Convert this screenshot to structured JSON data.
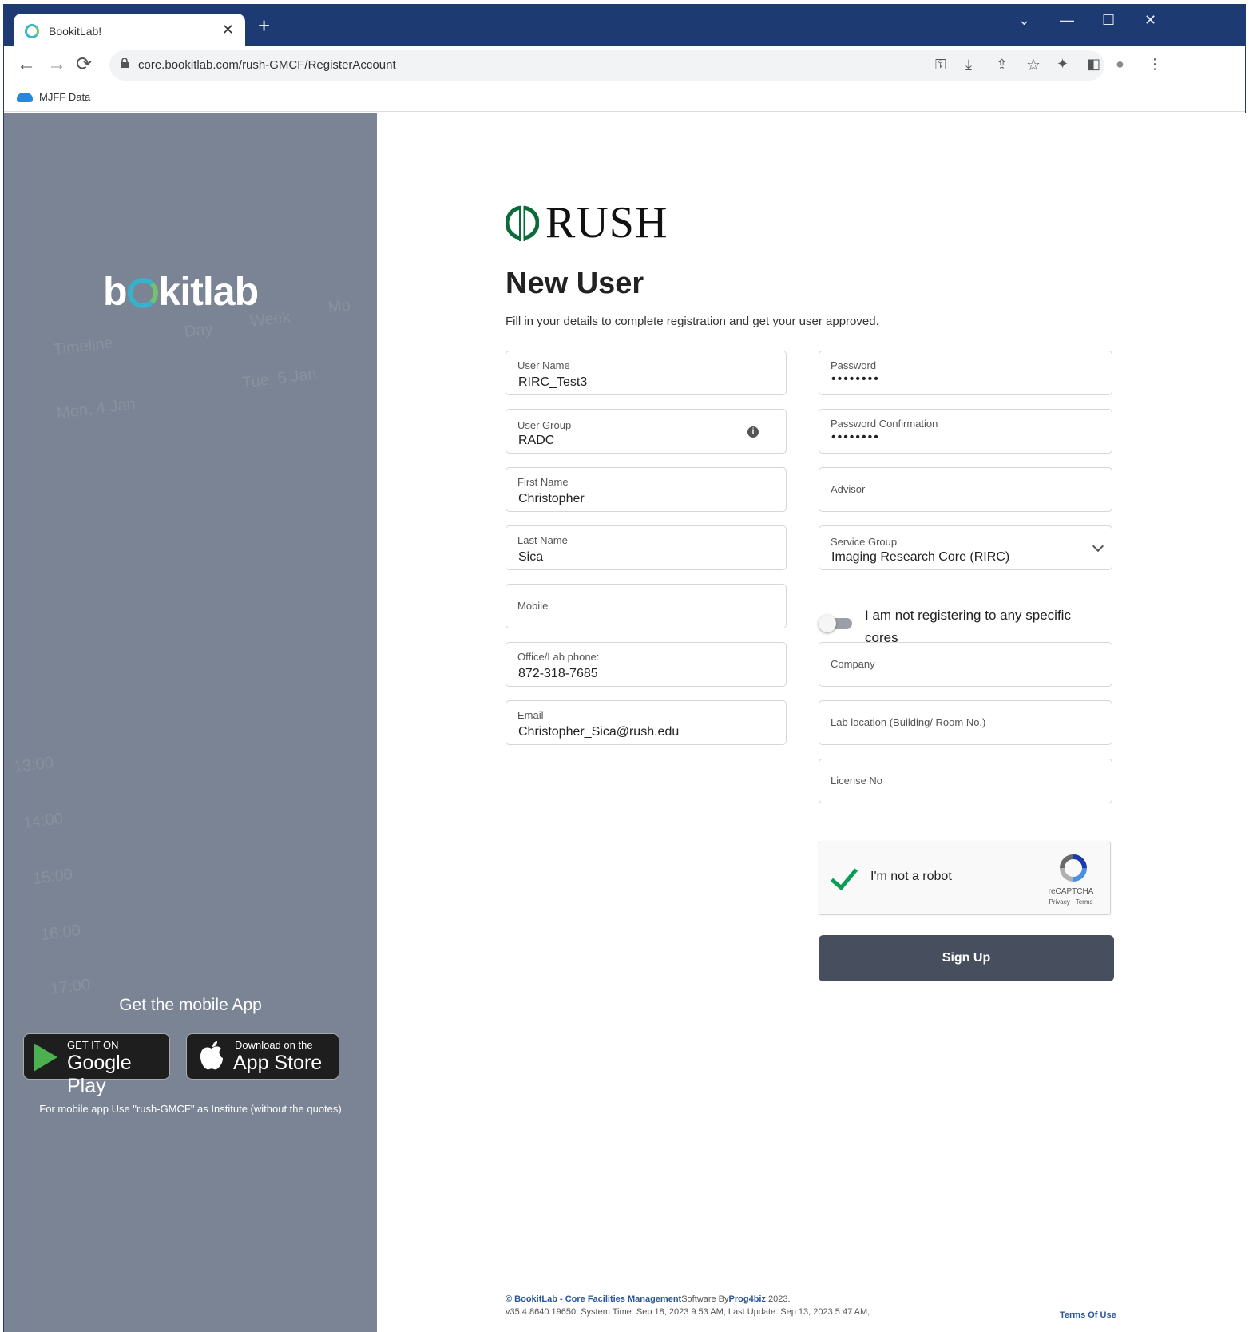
{
  "browser": {
    "tab_title": "BookitLab!",
    "tab_close": "✕",
    "new_tab": "+",
    "url": "core.bookitlab.com/rush-GMCF/RegisterAccount",
    "bookmark": "MJFF Data",
    "win_dropdown": "⌄",
    "win_minimize": "—",
    "win_maximize": "☐",
    "win_close": "✕",
    "back": "←",
    "forward": "→",
    "reload": "⟳",
    "tb_key": "⚿",
    "tb_install": "⤓",
    "tb_share": "⇪",
    "tb_star": "☆",
    "tb_ext": "✦",
    "tb_side": "◧",
    "tb_profile": "●",
    "tb_menu": "⋮"
  },
  "left": {
    "brand_pre": "b",
    "brand_post": "kitlab",
    "bg_labels": [
      "Timeline",
      "Day",
      "Week",
      "Mo",
      "Mon, 4 Jan",
      "Tue, 5 Jan",
      "13:00",
      "14:00",
      "15:00",
      "16:00",
      "17:00"
    ],
    "get_app": "Get the mobile App",
    "google_small": "GET IT ON",
    "google_big": "Google Play",
    "apple_small": "Download on the",
    "apple_big": "App Store",
    "note": "For mobile app Use \"rush-GMCF\" as Institute (without the quotes)"
  },
  "main": {
    "logo_text": "RUSH",
    "title": "New User",
    "subtitle": "Fill in your details to complete registration and get your user approved.",
    "fields": {
      "username": {
        "label": "User Name",
        "value": "RIRC_Test3"
      },
      "usergroup": {
        "label": "User Group",
        "value": "RADC",
        "info": "i"
      },
      "firstname": {
        "label": "First Name",
        "value": "Christopher"
      },
      "lastname": {
        "label": "Last Name",
        "value": "Sica"
      },
      "mobile": {
        "label": "Mobile"
      },
      "phone": {
        "label": "Office/Lab phone:",
        "value": "872-318-7685"
      },
      "email": {
        "label": "Email",
        "value": "Christopher_Sica@rush.edu"
      },
      "password": {
        "label": "Password",
        "value": "••••••••"
      },
      "password_confirm": {
        "label": "Password Confirmation",
        "value": "••••••••"
      },
      "advisor": {
        "label": "Advisor"
      },
      "service_group": {
        "label": "Service Group",
        "value": "Imaging Research Core (RIRC)"
      },
      "company": {
        "label": "Company"
      },
      "lab_location": {
        "label": "Lab location (Building/ Room No.)"
      },
      "license": {
        "label": "License No"
      }
    },
    "toggle_label": "I am not registering to any specific cores",
    "toggle_on": false,
    "captcha": {
      "text": "I'm not a robot",
      "brand": "reCAPTCHA",
      "links": "Privacy - Terms"
    },
    "signup": "Sign Up",
    "footer": {
      "copyright_link": "© BookitLab - Core Facilities Management",
      "software_by": "Software By",
      "company_link": "Prog4biz",
      "year": " 2023.",
      "version_line": "v35.4.8640.19650; System Time: Sep 18, 2023 9:53 AM; Last Update: Sep 13, 2023 5:47 AM;",
      "terms": "Terms Of Use"
    }
  },
  "colors": {
    "titlebar": "#1d3b72",
    "left_panel": "#7a8494",
    "signup_button": "#474e5d",
    "rush_green": "#0b6b3a",
    "captcha_check": "#0a9d58"
  }
}
